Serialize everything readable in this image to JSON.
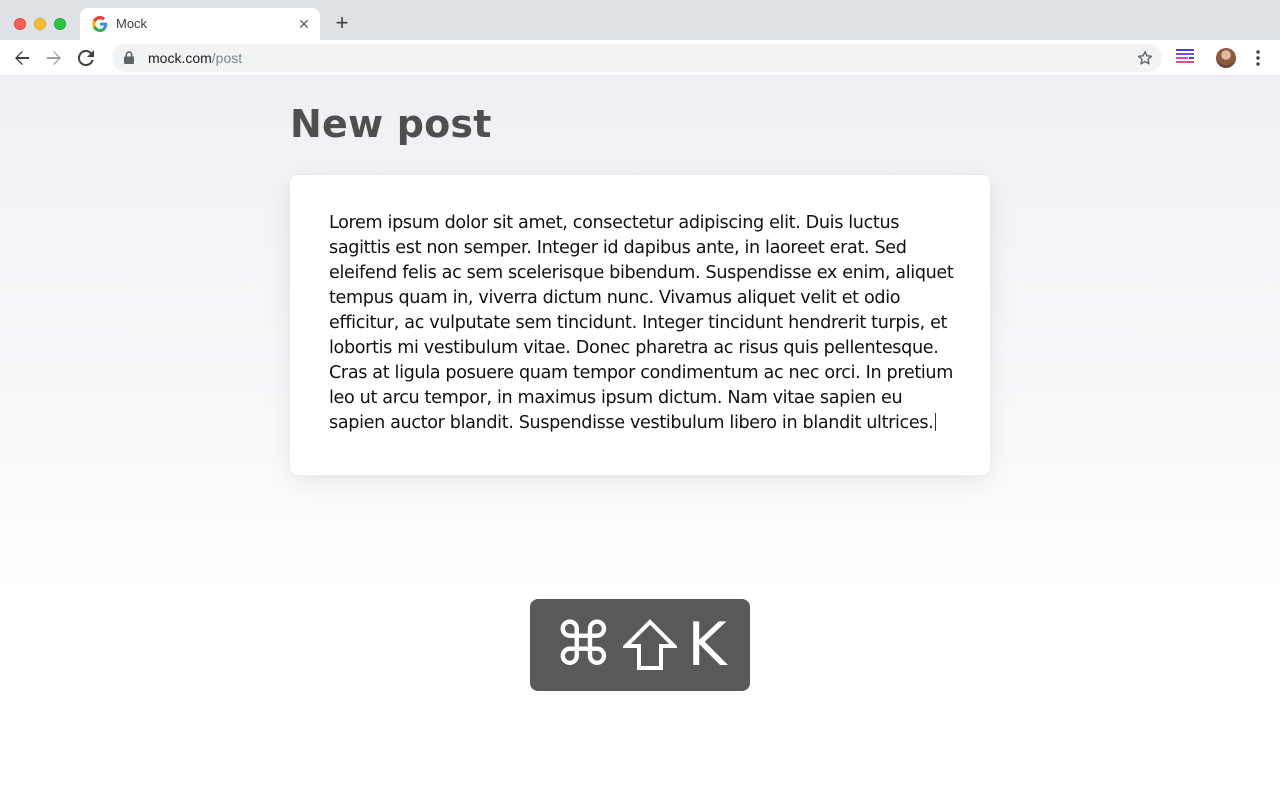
{
  "browser": {
    "tab": {
      "title": "Mock",
      "favicon": "google-g-icon"
    },
    "address_bar": {
      "domain": "mock.com",
      "path": "/post"
    }
  },
  "page": {
    "title": "New post",
    "post_body": "Lorem ipsum dolor sit amet, consectetur adipiscing elit. Duis luctus sagittis est non semper. Integer id dapibus ante, in laoreet erat. Sed eleifend felis ac sem scelerisque bibendum. Suspendisse ex enim, aliquet tempus quam in, viverra dictum nunc. Vivamus aliquet velit et odio efficitur, ac vulputate sem tincidunt. Integer tincidunt hendrerit turpis, et lobortis mi vestibulum vitae. Donec pharetra ac risus quis pellentesque. Cras at ligula posuere quam tempor condimentum ac nec orci. In pretium leo ut arcu tempor, in maximus ipsum dictum. Nam vitae sapien eu sapien auctor blandit. Suspendisse vestibulum libero in blandit ultrices."
  },
  "shortcut_hud": {
    "keys": [
      "⌘",
      "⇧",
      "K"
    ]
  },
  "colors": {
    "title": "#4f4f4f",
    "hud_background": "#595959"
  }
}
